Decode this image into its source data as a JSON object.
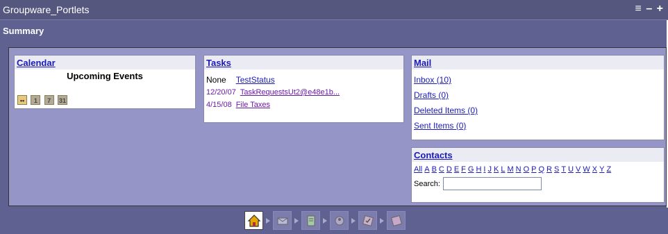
{
  "portlet": {
    "title": "Groupware_Portlets",
    "controls": "≡ – +",
    "section_title": "Summary"
  },
  "calendar": {
    "header": "Calendar",
    "upcoming": "Upcoming Events",
    "icons": [
      {
        "name": "day-view-icon",
        "text": "••"
      },
      {
        "name": "one-day-icon",
        "text": "1"
      },
      {
        "name": "seven-day-icon",
        "text": "7"
      },
      {
        "name": "month-view-icon",
        "text": "31"
      }
    ]
  },
  "tasks": {
    "header": "Tasks",
    "items": [
      {
        "date": "None",
        "label": "TestStatus"
      },
      {
        "date": "12/20/07",
        "label": "TaskRequestsUt2@e48e1b..."
      },
      {
        "date": "4/15/08",
        "label": "File Taxes"
      }
    ]
  },
  "mail": {
    "header": "Mail",
    "items": [
      "Inbox (10)",
      "Drafts (0)",
      "Deleted Items (0)",
      "Sent Items (0)"
    ]
  },
  "contacts": {
    "header": "Contacts",
    "letters": [
      "All",
      "A",
      "B",
      "C",
      "D",
      "E",
      "F",
      "G",
      "H",
      "I",
      "J",
      "K",
      "L",
      "M",
      "N",
      "O",
      "P",
      "Q",
      "R",
      "S",
      "T",
      "U",
      "V",
      "W",
      "X",
      "Y",
      "Z"
    ],
    "search_label": "Search:",
    "search_value": ""
  },
  "nav": {
    "icons": [
      "home-icon",
      "mail-icon",
      "notes-icon",
      "contacts-icon",
      "tasks-icon",
      "calendar-icon"
    ]
  }
}
